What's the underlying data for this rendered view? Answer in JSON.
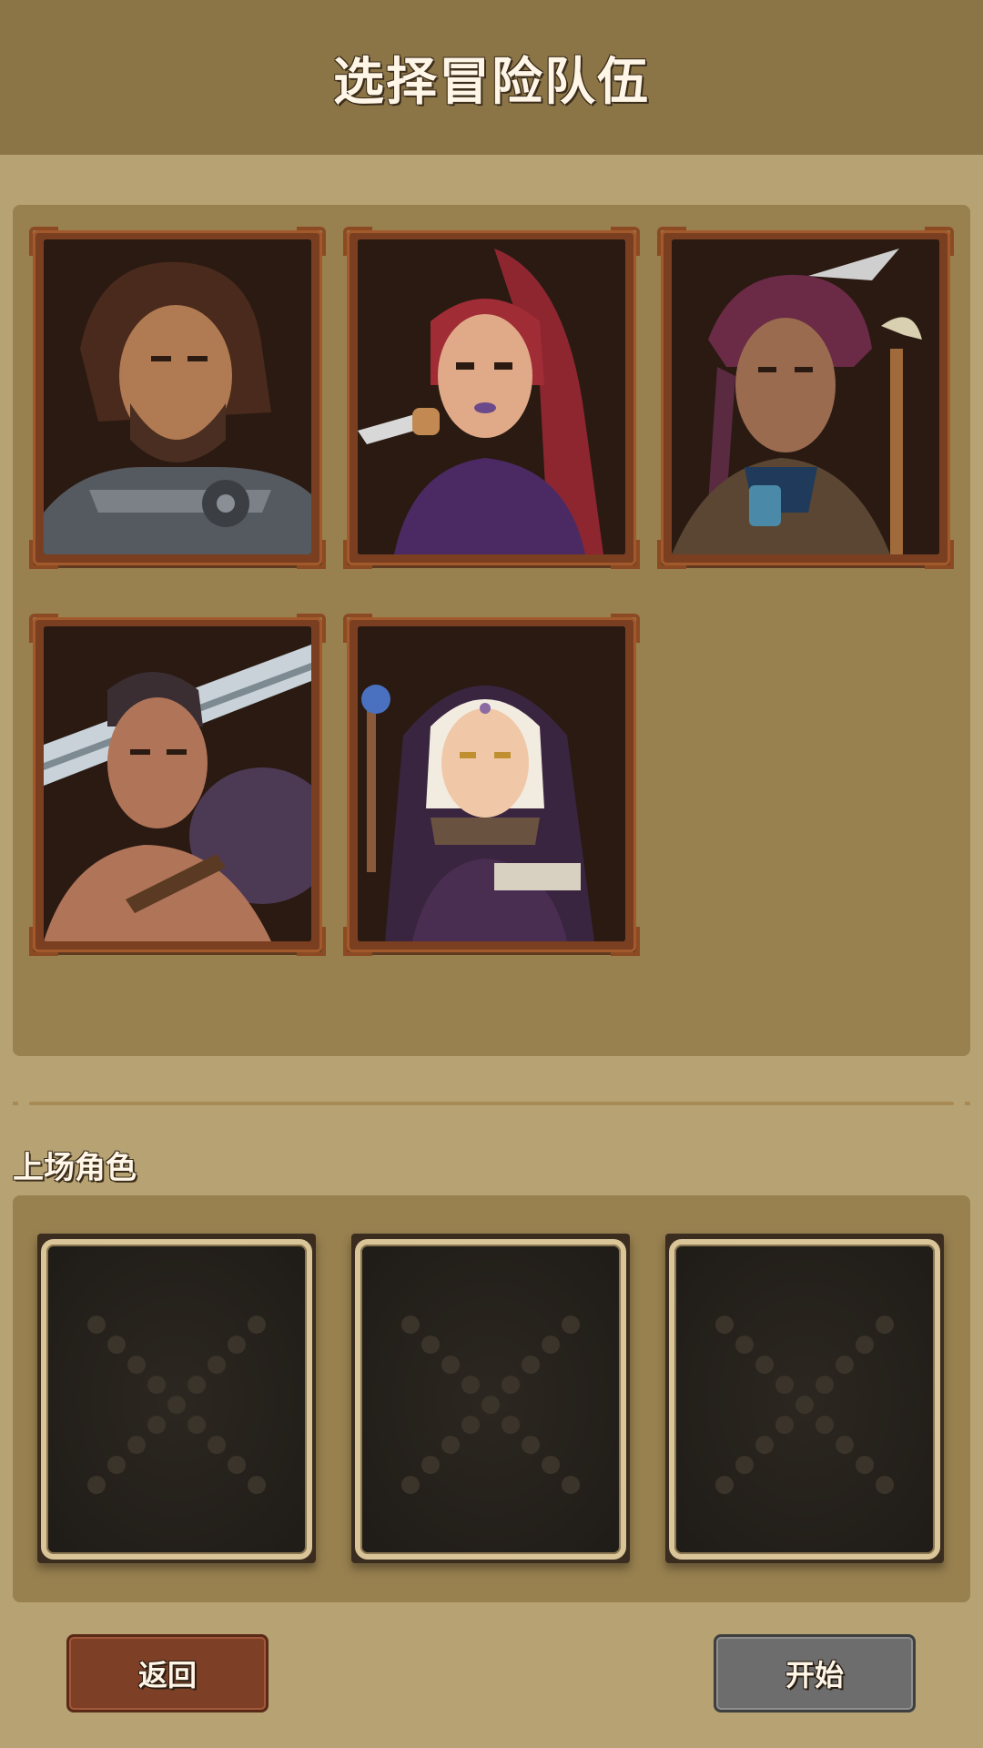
{
  "header": {
    "title": "选择冒险队伍"
  },
  "roster": {
    "heroes": [
      {
        "portrait": "bearded-warrior-portrait-icon"
      },
      {
        "portrait": "red-haired-rogue-portrait-icon"
      },
      {
        "portrait": "feathered-shaman-portrait-icon"
      },
      {
        "portrait": "greatsword-barbarian-portrait-icon"
      },
      {
        "portrait": "nun-cleric-portrait-icon"
      }
    ]
  },
  "lineup": {
    "label": "上场角色",
    "slots": [
      {
        "state": "empty",
        "icon": "empty-slot-x-icon"
      },
      {
        "state": "empty",
        "icon": "empty-slot-x-icon"
      },
      {
        "state": "empty",
        "icon": "empty-slot-x-icon"
      }
    ]
  },
  "buttons": {
    "back": "返回",
    "start": "开始"
  },
  "colors": {
    "background": "#b7a274",
    "header": "#8b7446",
    "panel": "#98804f",
    "card_frame": "#7a3f20",
    "back_button": "#7e3f27",
    "start_button": "#6d6d6d"
  }
}
